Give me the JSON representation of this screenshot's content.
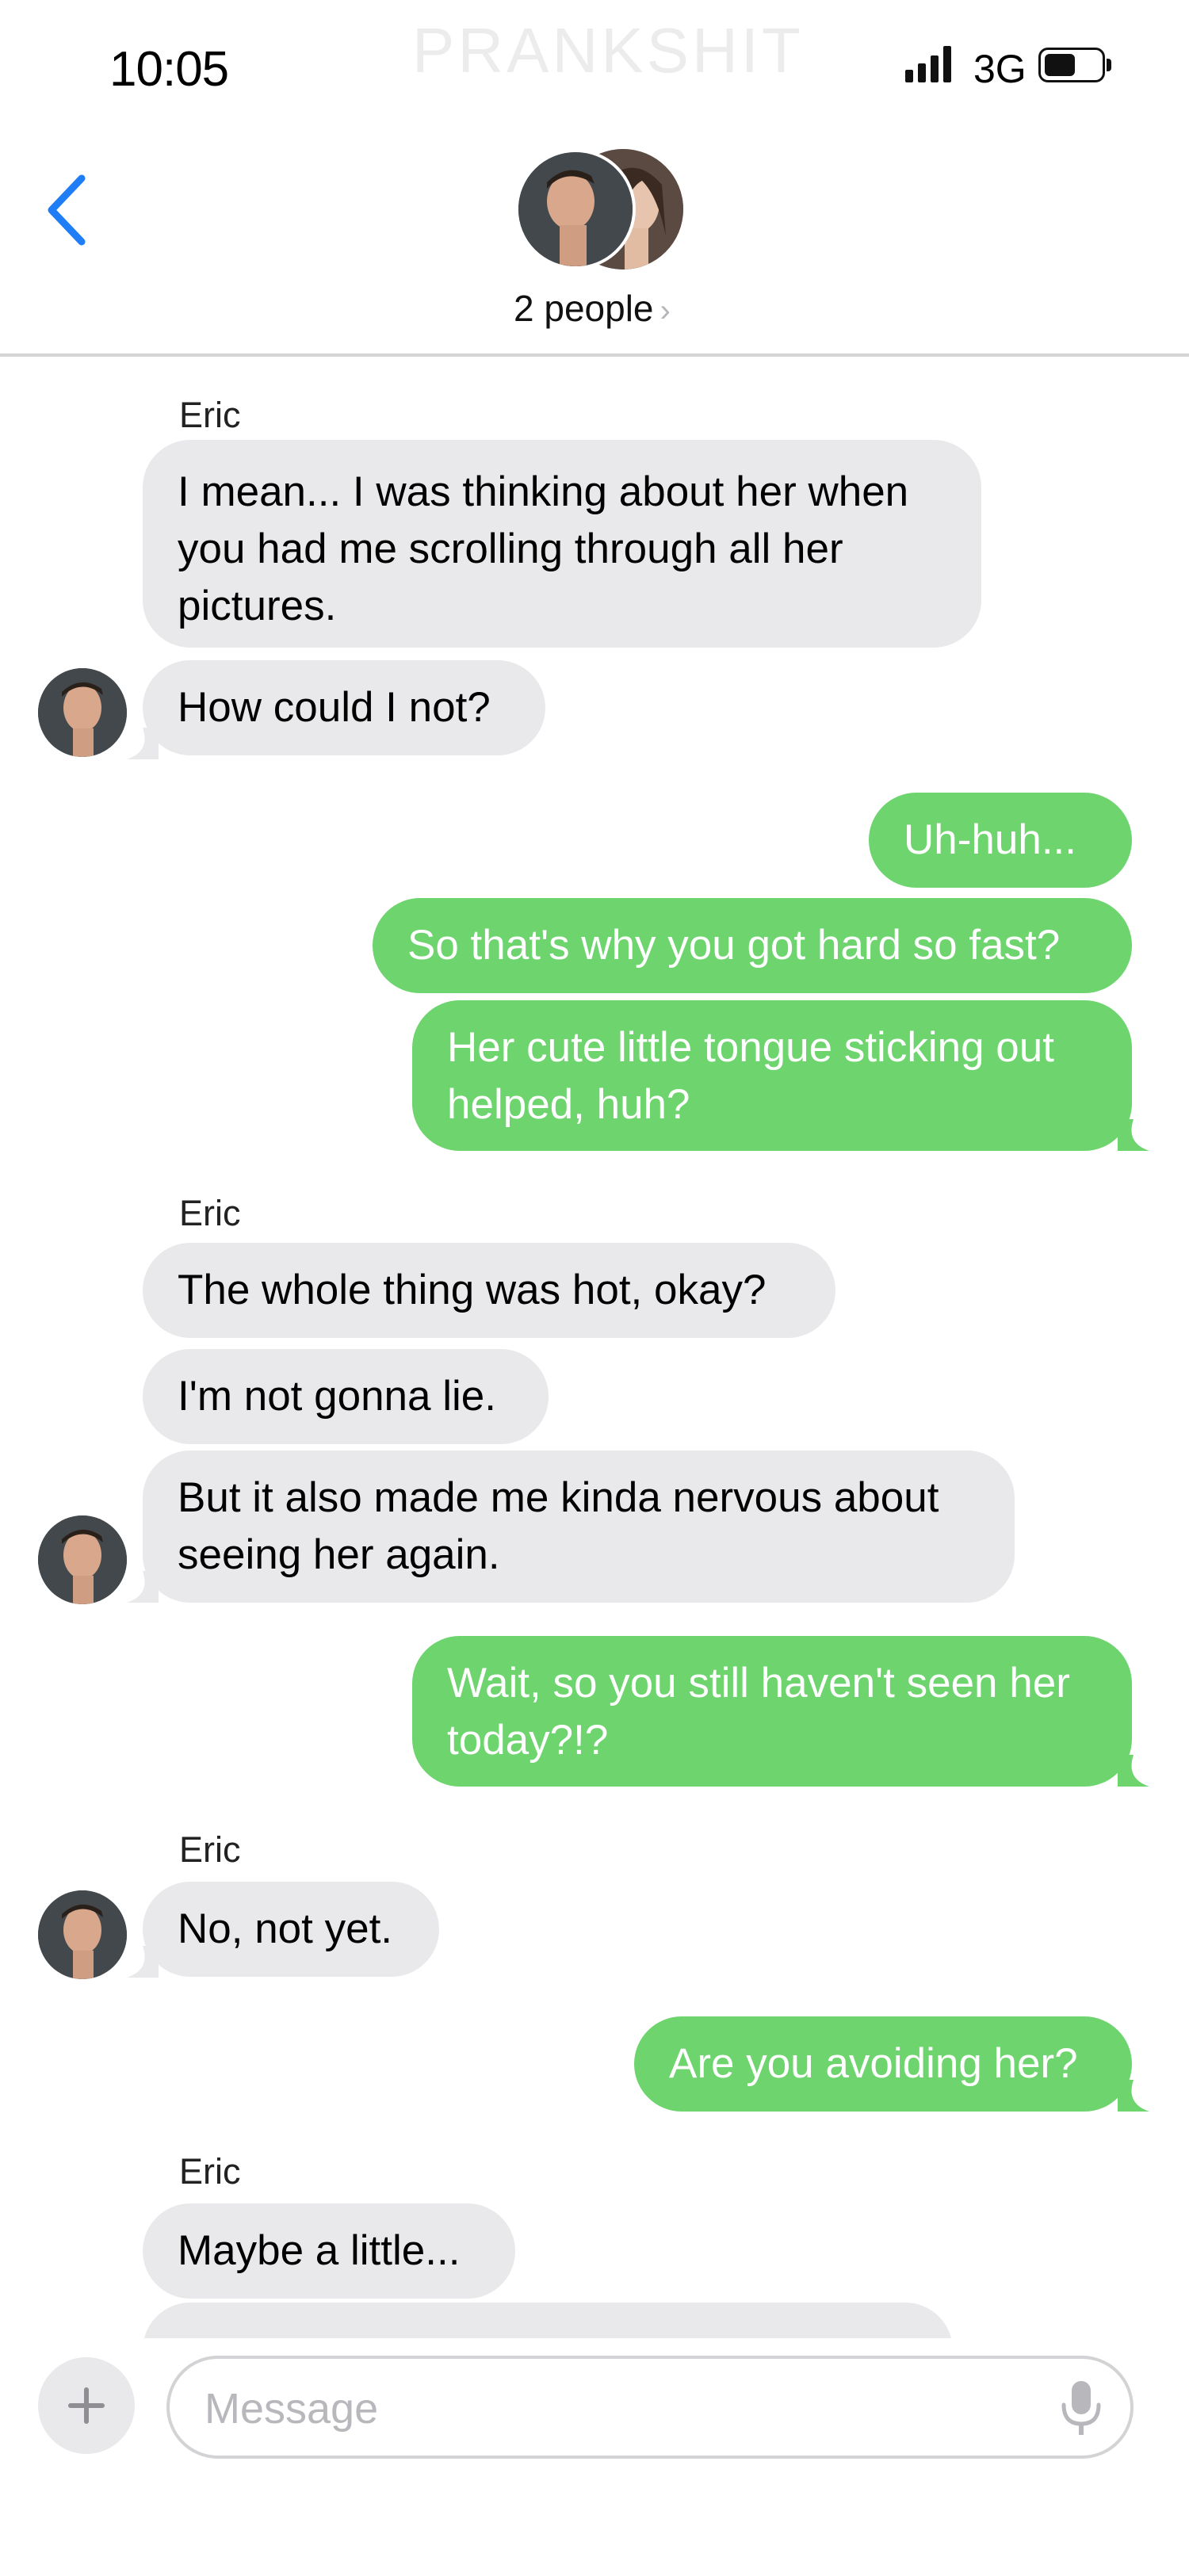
{
  "status_bar": {
    "time": "10:05",
    "network": "3G"
  },
  "watermark": "PRANKSHIT",
  "header": {
    "group_label": "2 people",
    "chevron": "›"
  },
  "messages": {
    "m1_sender": "Eric",
    "m1_l1": "I mean... I was thinking about her when",
    "m1_l2": "you had me scrolling through all her",
    "m1_l3": "pictures.",
    "m2": "How could I not?",
    "m3": "Uh-huh...",
    "m4": "So that's why you got hard so fast?",
    "m5_l1": "Her cute little tongue sticking out",
    "m5_l2": "helped, huh?",
    "m6_sender": "Eric",
    "m6": "The whole thing was hot, okay?",
    "m7": "I'm not gonna lie.",
    "m8_l1": "But it also made me kinda nervous about",
    "m8_l2": "seeing her again.",
    "m9_l1": "Wait, so you still haven't seen her",
    "m9_l2": "today?!?",
    "m10_sender": "Eric",
    "m10": "No, not yet.",
    "m11": "Are you avoiding her?",
    "m12_sender": "Eric",
    "m12": "Maybe a little..."
  },
  "input": {
    "placeholder": "Message"
  },
  "colors": {
    "outgoing": "#6dd46e",
    "incoming": "#e9e9eb",
    "accent": "#1f7df5"
  },
  "icons": [
    "back-chevron-icon",
    "signal-icon",
    "battery-icon",
    "plus-icon",
    "microphone-icon"
  ]
}
